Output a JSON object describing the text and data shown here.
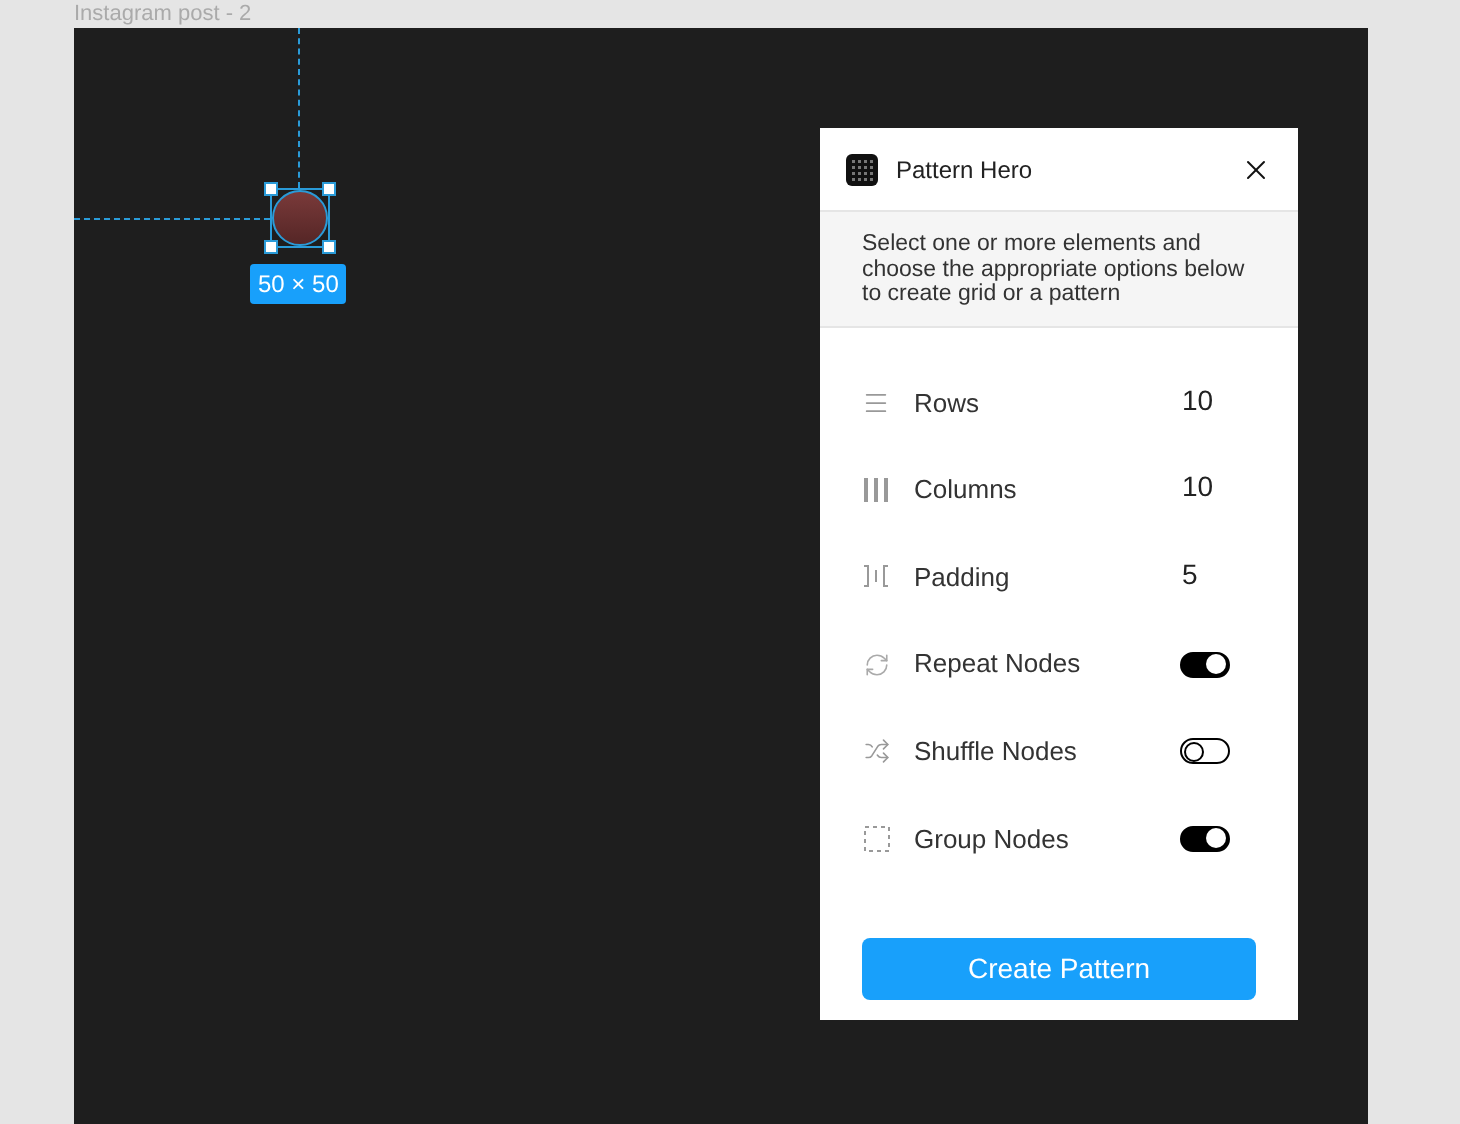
{
  "frame": {
    "title": "Instagram post - 2",
    "selection_size": "50 × 50"
  },
  "panel": {
    "title": "Pattern Hero",
    "description": "Select one or more elements and choose the appropriate options below to create grid or a pattern",
    "options": [
      {
        "kind": "number",
        "label": "Rows",
        "value": "10"
      },
      {
        "kind": "number",
        "label": "Columns",
        "value": "10"
      },
      {
        "kind": "number",
        "label": "Padding",
        "value": "5"
      },
      {
        "kind": "toggle",
        "label": "Repeat Nodes",
        "on": true
      },
      {
        "kind": "toggle",
        "label": "Shuffle Nodes",
        "on": false
      },
      {
        "kind": "toggle",
        "label": "Group Nodes",
        "on": true
      }
    ],
    "button": "Create Pattern"
  }
}
